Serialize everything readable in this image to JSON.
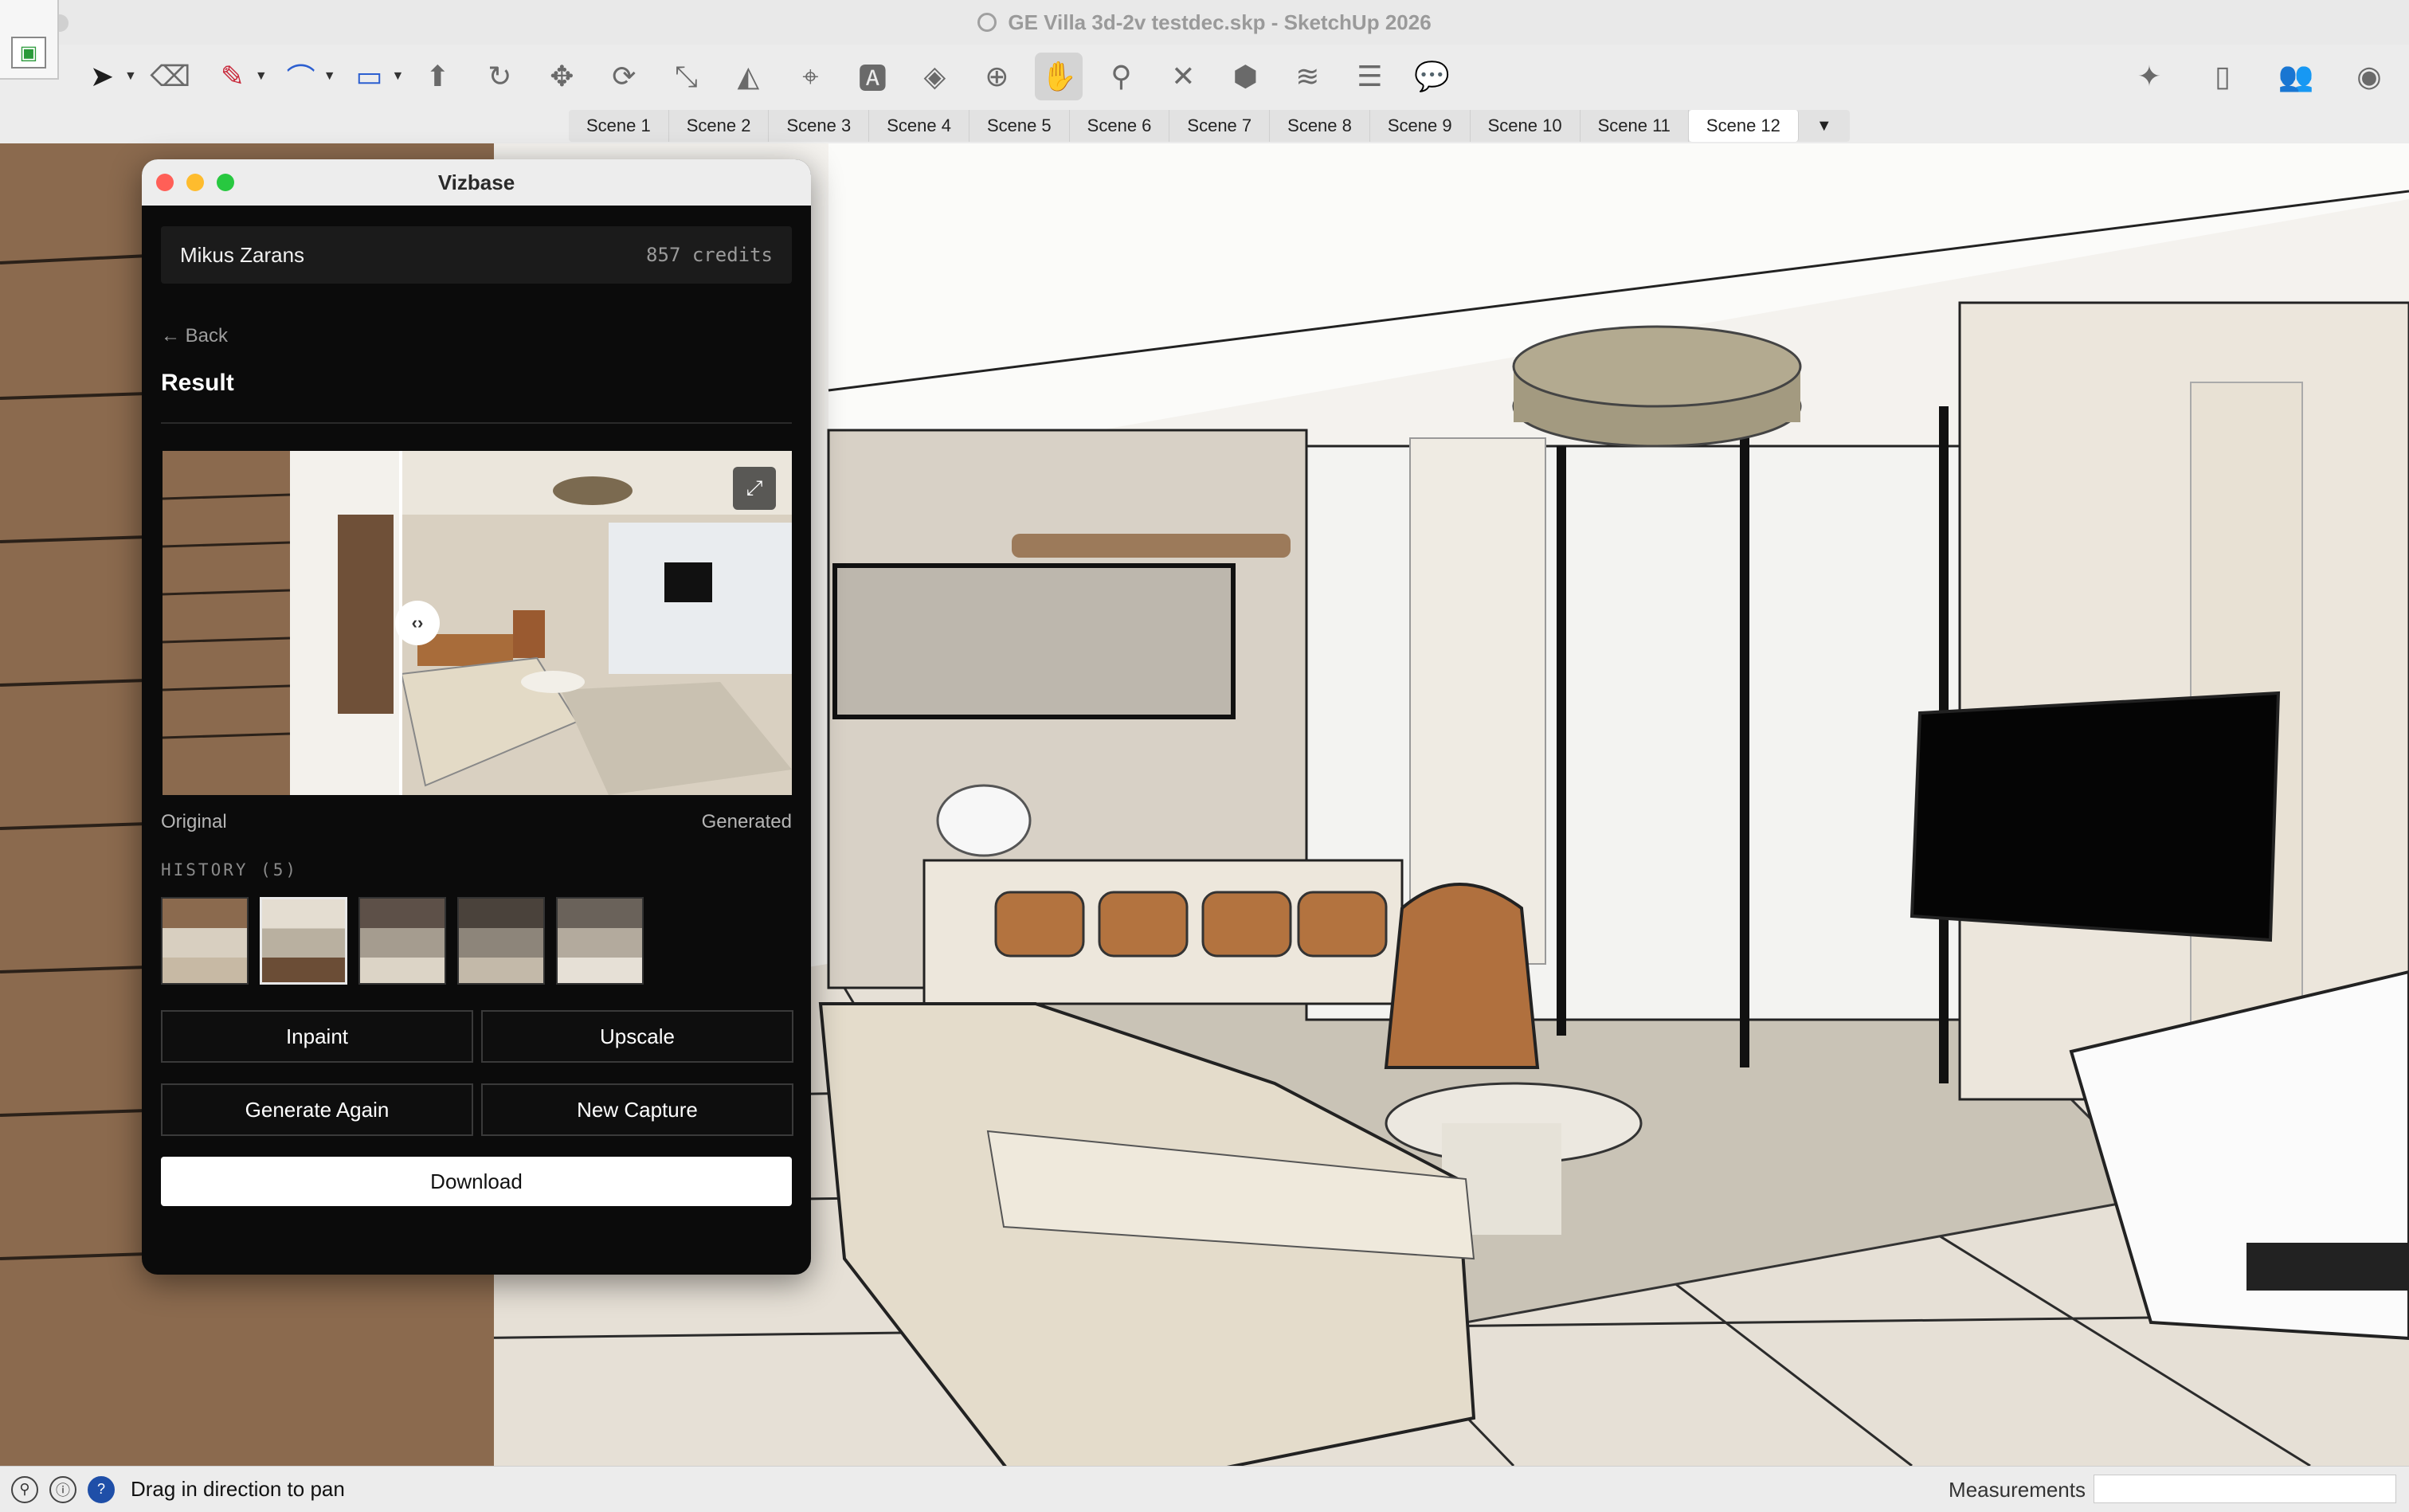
{
  "window": {
    "title": "GE Villa 3d-2v testdec.skp - SketchUp 2026"
  },
  "toolbar": {
    "tools": [
      {
        "name": "select-tool",
        "icon": "arrow-icon"
      },
      {
        "name": "eraser-tool",
        "icon": "eraser-icon"
      },
      {
        "name": "pencil-tool",
        "icon": "pencil-icon"
      },
      {
        "name": "arc-tool",
        "icon": "arc-icon"
      },
      {
        "name": "rectangle-tool",
        "icon": "rectangle-icon"
      },
      {
        "name": "push-pull-tool",
        "icon": "push-pull-icon"
      },
      {
        "name": "follow-me-tool",
        "icon": "follow-me-icon"
      },
      {
        "name": "move-tool",
        "icon": "move-icon"
      },
      {
        "name": "rotate-tool",
        "icon": "rotate-icon"
      },
      {
        "name": "scale-tool",
        "icon": "scale-icon"
      },
      {
        "name": "flip-tool",
        "icon": "flip-icon"
      },
      {
        "name": "tape-measure-tool",
        "icon": "tape-icon"
      },
      {
        "name": "text-tool",
        "icon": "text-icon"
      },
      {
        "name": "paint-bucket-tool",
        "icon": "paint-icon"
      },
      {
        "name": "orbit-tool",
        "icon": "orbit-icon"
      },
      {
        "name": "pan-tool",
        "icon": "hand-icon"
      },
      {
        "name": "zoom-tool",
        "icon": "zoom-icon"
      },
      {
        "name": "zoom-extents-tool",
        "icon": "zoom-extents-icon"
      },
      {
        "name": "component-tool",
        "icon": "component-icon"
      },
      {
        "name": "section-tool",
        "icon": "section-icon"
      },
      {
        "name": "layers-tool",
        "icon": "layers-icon"
      },
      {
        "name": "chat-tool",
        "icon": "chat-icon"
      }
    ],
    "right_tools": [
      "sparkle-icon",
      "document-icon",
      "people-icon",
      "account-icon"
    ]
  },
  "scenes": {
    "tabs": [
      "Scene 1",
      "Scene 2",
      "Scene 3",
      "Scene 4",
      "Scene 5",
      "Scene 6",
      "Scene 7",
      "Scene 8",
      "Scene 9",
      "Scene 10",
      "Scene 11",
      "Scene 12"
    ],
    "active_index": 11,
    "more_symbol": "▼"
  },
  "vizbase": {
    "title": "Vizbase",
    "user_name": "Mikus Zarans",
    "credits": "857 credits",
    "back_label": "← Back",
    "heading": "Result",
    "original_label": "Original",
    "generated_label": "Generated",
    "history_label": "HISTORY (5)",
    "history_count": 5,
    "history_selected": 1,
    "buttons": {
      "inpaint": "Inpaint",
      "upscale": "Upscale",
      "generate_again": "Generate Again",
      "new_capture": "New Capture",
      "download": "Download"
    },
    "handle_symbol": "‹›",
    "expand_symbol": "⤢"
  },
  "status": {
    "hint": "Drag in direction to pan",
    "measurements_label": "Measurements",
    "measurements_value": ""
  },
  "colors": {
    "panel_bg": "#0b0b0b",
    "close": "#ff5f57",
    "minimize": "#febc2e",
    "maximize": "#28c840",
    "accent_blue": "#2c5fd0"
  }
}
